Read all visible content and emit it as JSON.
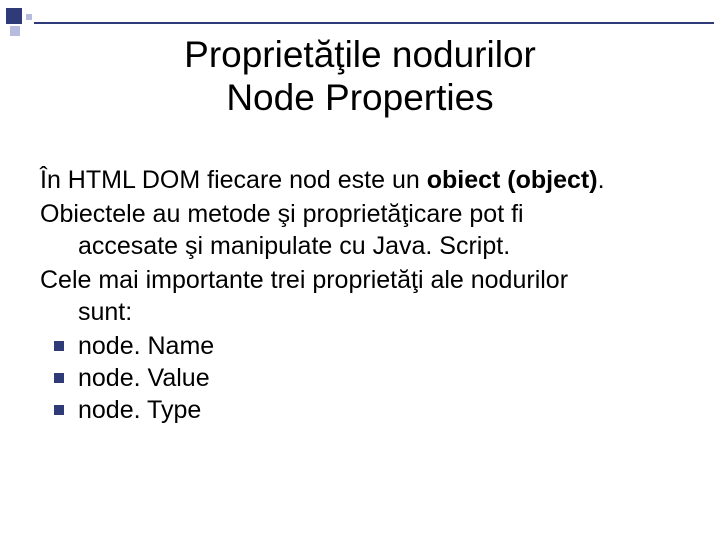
{
  "title": {
    "line1": "Proprietăţile nodurilor",
    "line2": "Node Properties"
  },
  "body": {
    "p1": {
      "pre": "În HTML DOM fiecare nod este un ",
      "bold": "obiect (object)",
      "post": "."
    },
    "p2": {
      "line1": "Obiectele au metode şi proprietăţicare pot fi",
      "line2": "accesate şi manipulate cu Java. Script."
    },
    "p3": {
      "line1": "Cele mai importante trei proprietăţi ale nodurilor",
      "line2": "sunt:"
    }
  },
  "bullets": [
    "node. Name",
    "node. Value",
    "node. Type"
  ]
}
